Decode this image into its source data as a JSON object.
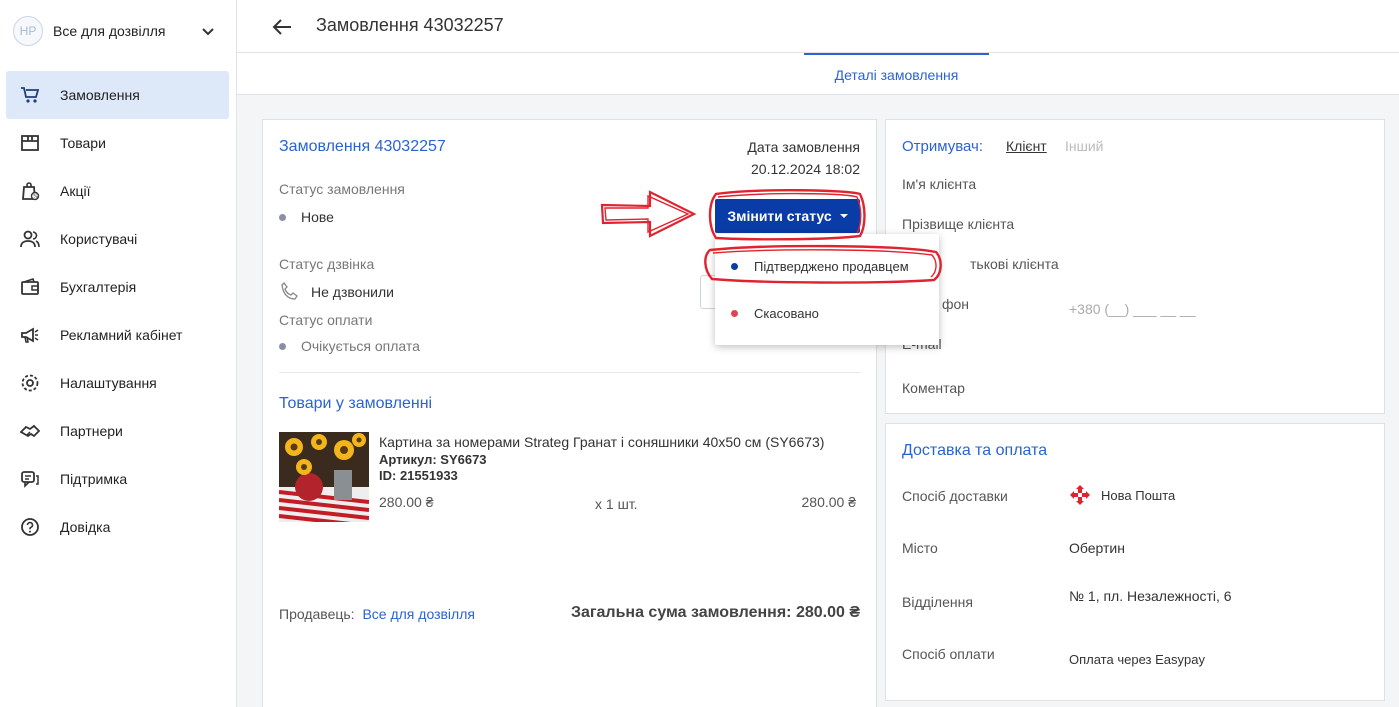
{
  "sidebar": {
    "avatar_initials": "HP",
    "shop_name": "Все для дозвілля",
    "items": [
      {
        "label": "Замовлення",
        "icon": "cart-icon",
        "active": true
      },
      {
        "label": "Товари",
        "icon": "box-icon"
      },
      {
        "label": "Акції",
        "icon": "promo-bag-icon"
      },
      {
        "label": "Користувачі",
        "icon": "users-icon"
      },
      {
        "label": "Бухгалтерія",
        "icon": "wallet-icon"
      },
      {
        "label": "Рекламний кабінет",
        "icon": "megaphone-icon"
      },
      {
        "label": "Налаштування",
        "icon": "gear-icon"
      },
      {
        "label": "Партнери",
        "icon": "handshake-icon"
      },
      {
        "label": "Підтримка",
        "icon": "chat-icon"
      },
      {
        "label": "Довідка",
        "icon": "help-icon"
      }
    ]
  },
  "header": {
    "title": "Замовлення 43032257"
  },
  "tabs": {
    "details": "Деталі замовлення"
  },
  "order": {
    "title": "Замовлення 43032257",
    "date_label": "Дата замовлення",
    "date_value": "20.12.2024 18:02",
    "status_label": "Статус замовлення",
    "status_value": "Нове",
    "change_status_button": "Змінити статус",
    "call_status_label": "Статус дзвінка",
    "call_status_value": "Не дзвонили",
    "payment_status_label": "Статус оплати",
    "payment_status_value": "Очікується оплата",
    "goods_title": "Товари у замовленні",
    "product": {
      "name": "Картина за номерами Strateg Гранат і соняшники 40х50 см (SY6673)",
      "sku": "Артикул: SY6673",
      "id": "ID: 21551933",
      "price": "280.00 ₴",
      "qty": "x 1 шт.",
      "sum": "280.00 ₴"
    },
    "seller_label": "Продавець:",
    "seller_name": "Все для дозвілля",
    "total": "Загальна сума замовлення: 280.00 ₴"
  },
  "dropdown": {
    "items": [
      {
        "label": "Підтверджено продавцем",
        "color": "#0a3ca8"
      },
      {
        "label": "Скасовано",
        "color": "#e0454f"
      }
    ]
  },
  "recipient": {
    "title": "Отримувач:",
    "tab_client": "Клієнт",
    "tab_other": "Інший",
    "first_name": "Ім'я клієнта",
    "last_name": "Прізвище клієнта",
    "middle_name_partial": "тькові клієнта",
    "phone_partial": "фон",
    "phone_placeholder": "+380 (__) ___ __ __",
    "email_partial": "E-mail",
    "comment": "Коментар"
  },
  "delivery": {
    "title": "Доставка та оплата",
    "method_label": "Спосіб доставки",
    "method_value": "Нова Пошта",
    "city_label": "Місто",
    "city_value": "Обертин",
    "branch_label": "Відділення",
    "branch_value": "№ 1, пл. Незалежності, 6",
    "payment_label": "Спосіб оплати",
    "payment_value": "Оплата через Easypay"
  },
  "colors": {
    "accent": "#2a63d4",
    "button": "#0a3ca8",
    "annotation": "#e0242f"
  }
}
